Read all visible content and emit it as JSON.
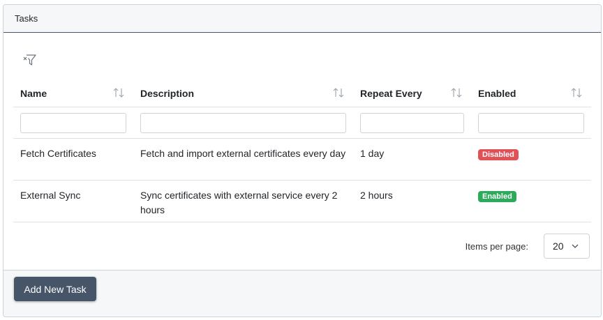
{
  "card": {
    "title": "Tasks"
  },
  "table": {
    "columns": [
      {
        "label": "Name"
      },
      {
        "label": "Description"
      },
      {
        "label": "Repeat Every"
      },
      {
        "label": "Enabled"
      }
    ],
    "rows": [
      {
        "name": "Fetch Certificates",
        "description": "Fetch and import external certificates every day",
        "repeat": "1 day",
        "status": "Disabled"
      },
      {
        "name": "External Sync",
        "description": "Sync certificates with external service every 2 hours",
        "repeat": "2 hours",
        "status": "Enabled"
      }
    ]
  },
  "pagination": {
    "label": "Items per page:",
    "value": "20"
  },
  "footer": {
    "add_button": "Add New Task"
  },
  "icons": {
    "filter": "filter-clear-icon",
    "sort": "sort-icon",
    "chevron": "chevron-down-icon"
  },
  "colors": {
    "primary_button": "#475569",
    "badge_disabled": "#e05257",
    "badge_enabled": "#2daa5a"
  }
}
